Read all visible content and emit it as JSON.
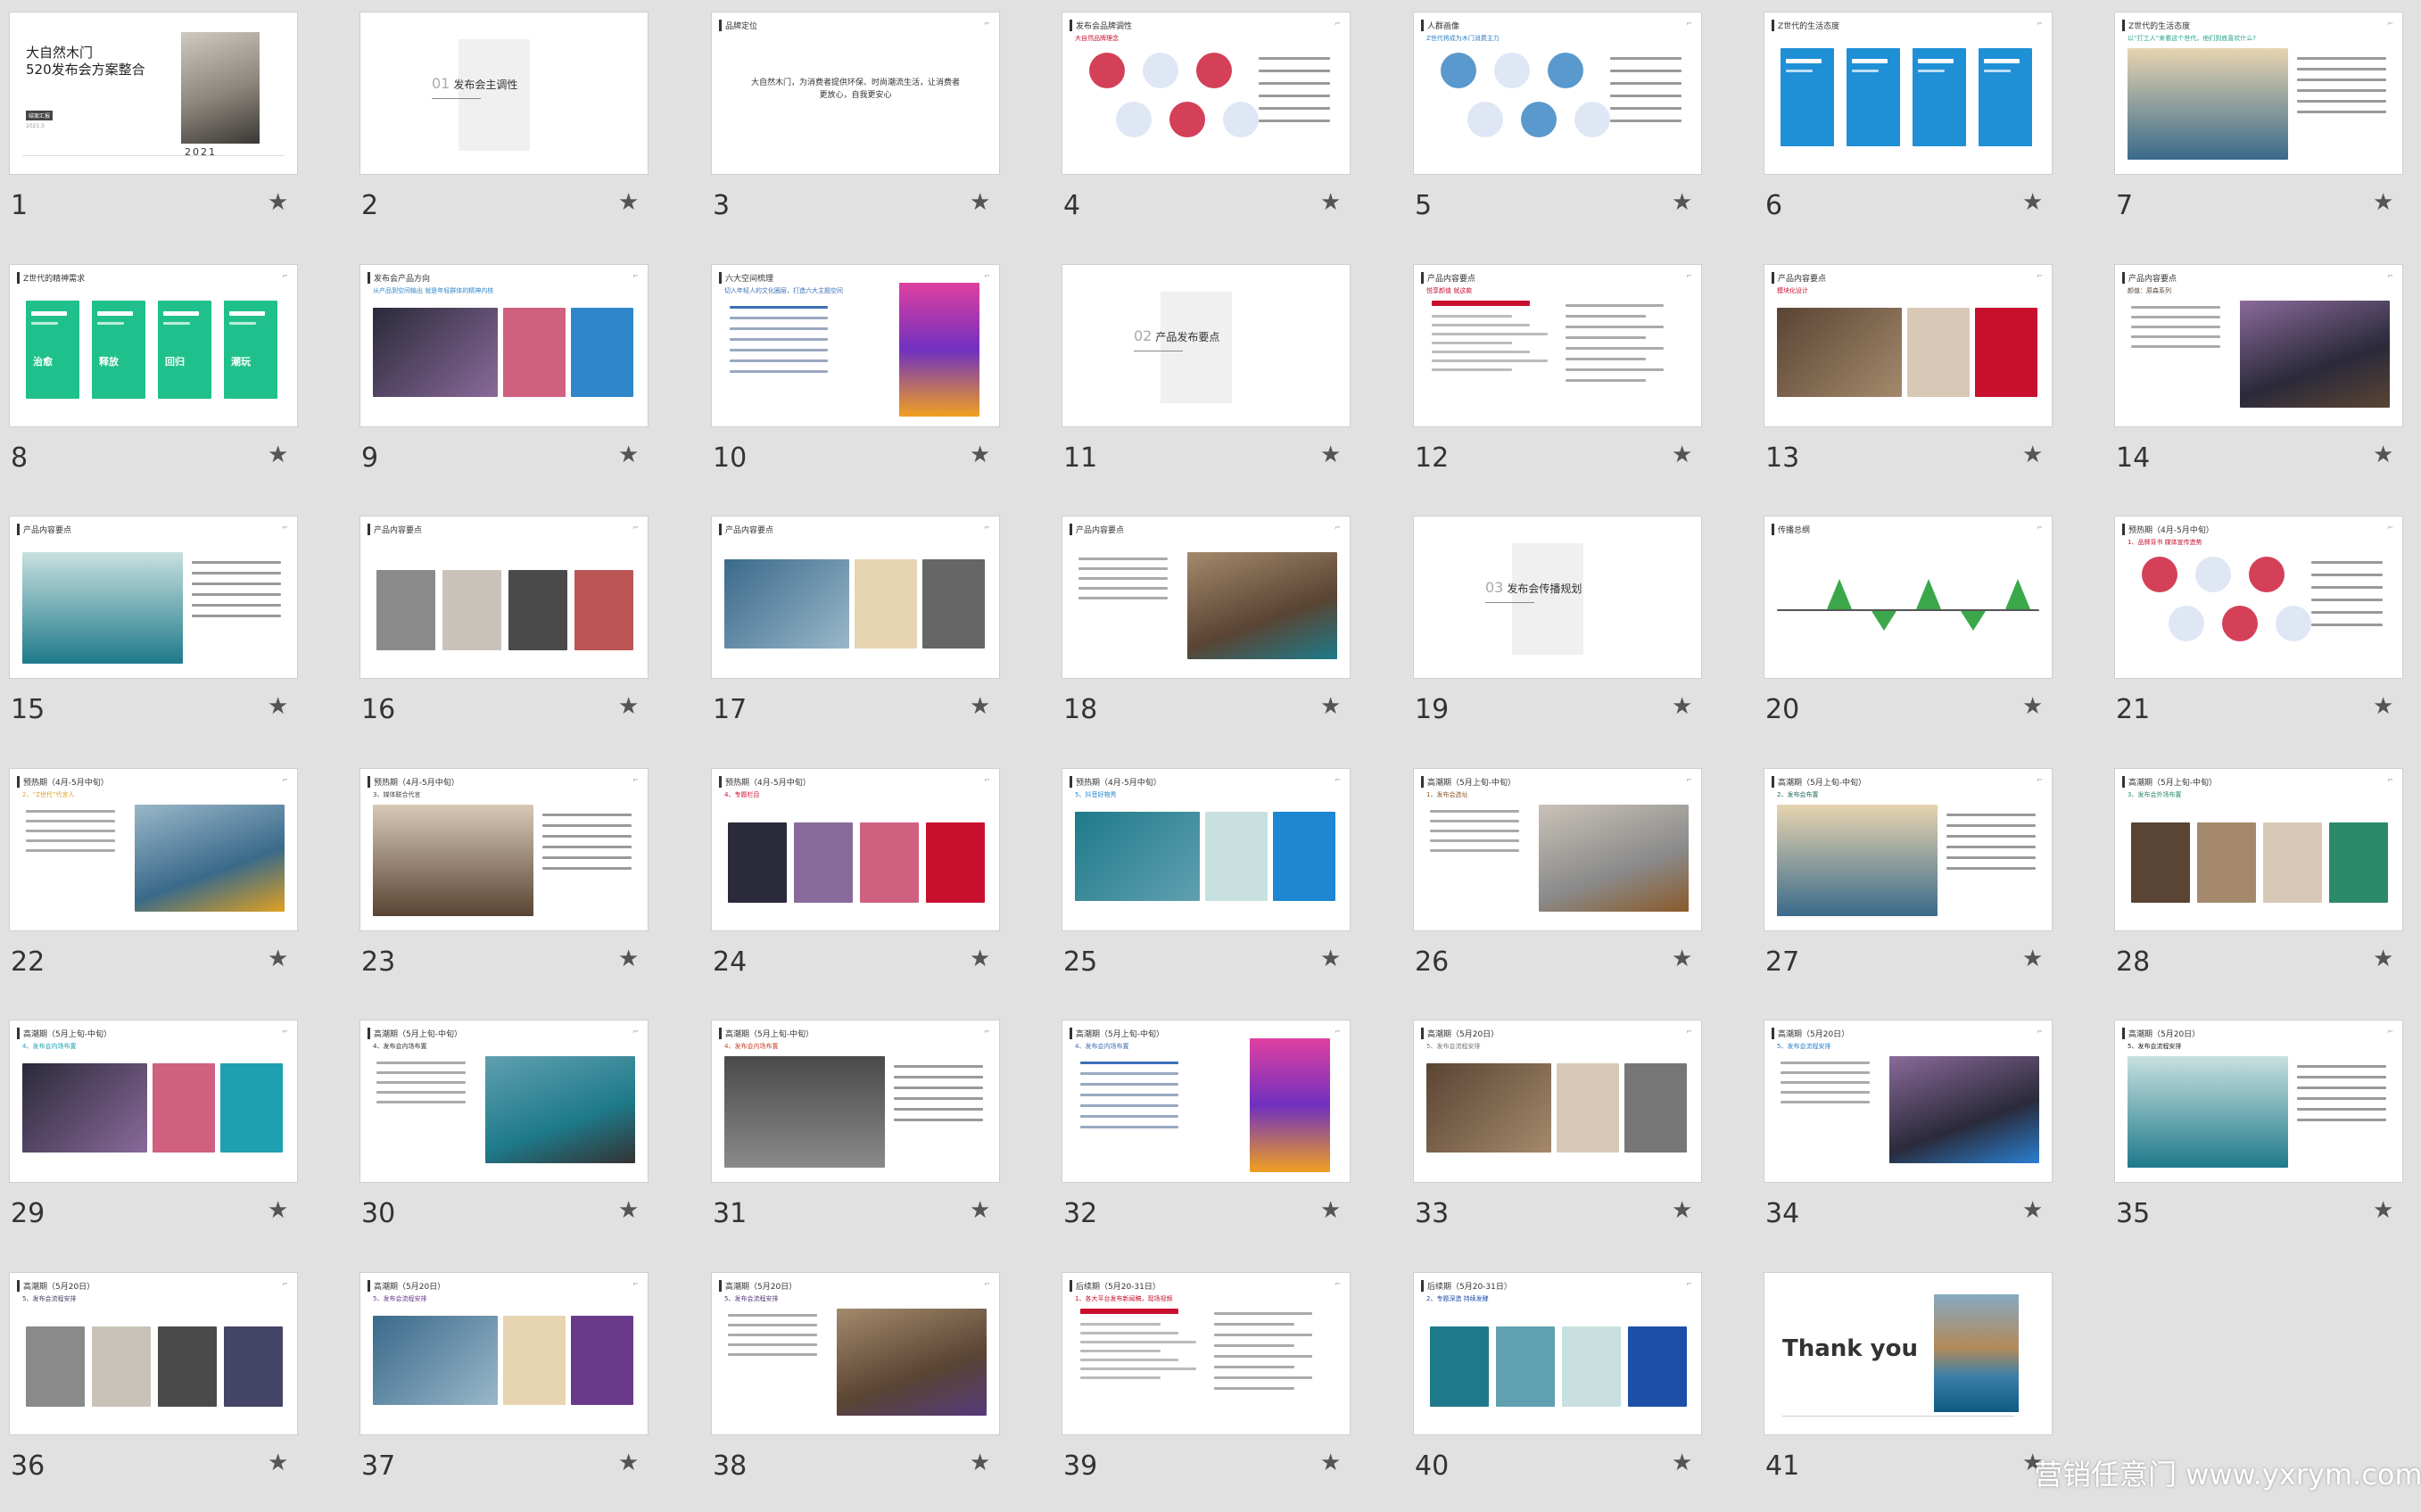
{
  "slides": [
    {
      "n": "1",
      "kind": "cover",
      "title_line1": "大自然木门",
      "title_line2": "520发布会方案整合",
      "tag": "结案汇报",
      "date": "2021.5",
      "year": "2021"
    },
    {
      "n": "2",
      "kind": "section",
      "index": "01",
      "title": "发布会主调性"
    },
    {
      "n": "3",
      "kind": "text",
      "title": "品牌定位",
      "center": "大自然木门，为消费者提供环保、时尚潮流生活，让消费者更放心，自我更安心",
      "accent": "#c8102e"
    },
    {
      "n": "4",
      "kind": "diagram",
      "title": "发布会品牌调性",
      "sub": "大自然品牌理念",
      "accent": "#c8102e"
    },
    {
      "n": "5",
      "kind": "diagram",
      "title": "人群画像",
      "sub": "Z世代将成为木门消费主力",
      "accent": "#2f7fc1"
    },
    {
      "n": "6",
      "kind": "blocks",
      "title": "Z世代的生活态度",
      "accent": "#1f8fd6"
    },
    {
      "n": "7",
      "kind": "photo",
      "title": "Z世代的生活态度",
      "sub": "以“打工人”来看这个世代，他们到底喜欢什么?",
      "accent": "#1fa38a"
    },
    {
      "n": "8",
      "kind": "blocks",
      "title": "Z世代的精神需求",
      "words": [
        "治愈",
        "释放",
        "回归",
        "潮玩"
      ],
      "accent": "#20c08c"
    },
    {
      "n": "9",
      "kind": "photo",
      "title": "发布会产品方向",
      "sub": "从产品到空间输出 就是年轻群体的精神内核",
      "accent": "#2f86c8"
    },
    {
      "n": "10",
      "kind": "list",
      "title": "六大空间梳理",
      "sub": "切入年轻人的文化圈层，打造六大主题空间",
      "accent": "#3b6fb6"
    },
    {
      "n": "11",
      "kind": "section",
      "index": "02",
      "title": "产品发布要点"
    },
    {
      "n": "12",
      "kind": "text",
      "title": "产品内容要点",
      "sub": "悦享颜值 就这款",
      "accent": "#c8102e"
    },
    {
      "n": "13",
      "kind": "photo",
      "title": "产品内容要点",
      "sub": "模块化设计",
      "accent": "#c8102e"
    },
    {
      "n": "14",
      "kind": "photo",
      "title": "产品内容要点",
      "sub": "颜值：原森系列",
      "accent": "#5a4433"
    },
    {
      "n": "15",
      "kind": "photo",
      "title": "产品内容要点",
      "accent": "#555"
    },
    {
      "n": "16",
      "kind": "photo",
      "title": "产品内容要点",
      "accent": "#b55"
    },
    {
      "n": "17",
      "kind": "photo",
      "title": "产品内容要点",
      "accent": "#666"
    },
    {
      "n": "18",
      "kind": "photo",
      "title": "产品内容要点",
      "accent": "#1e7a8a"
    },
    {
      "n": "19",
      "kind": "section",
      "index": "03",
      "title": "发布会传播规划"
    },
    {
      "n": "20",
      "kind": "chart",
      "title": "传播总纲",
      "accent": "#3aa84a"
    },
    {
      "n": "21",
      "kind": "diagram",
      "title": "预热期（4月-5月中旬）",
      "sub": "1、品牌背书 媒体宣传造势",
      "accent": "#c8102e"
    },
    {
      "n": "22",
      "kind": "photo",
      "title": "预热期（4月-5月中旬）",
      "sub": "2、“Z世代”代言人",
      "accent": "#e0a020"
    },
    {
      "n": "23",
      "kind": "photo",
      "title": "预热期（4月-5月中旬）",
      "sub": "3、媒体联合代言",
      "accent": "#444"
    },
    {
      "n": "24",
      "kind": "photo",
      "title": "预热期（4月-5月中旬）",
      "sub": "4、专题栏目",
      "accent": "#c8102e"
    },
    {
      "n": "25",
      "kind": "photo",
      "title": "预热期（4月-5月中旬）",
      "sub": "5、抖音好物秀",
      "accent": "#1d87d1"
    },
    {
      "n": "26",
      "kind": "photo",
      "title": "高潮期（5月上旬-中旬）",
      "sub": "1、发布会选址",
      "accent": "#8a5a2a"
    },
    {
      "n": "27",
      "kind": "photo",
      "title": "高潮期（5月上旬-中旬）",
      "sub": "2、发布会布置",
      "accent": "#1e6e5e"
    },
    {
      "n": "28",
      "kind": "photo",
      "title": "高潮期（5月上旬-中旬）",
      "sub": "3、发布会外场布置",
      "accent": "#2a8a6a"
    },
    {
      "n": "29",
      "kind": "photo",
      "title": "高潮期（5月上旬-中旬）",
      "sub": "4、发布会内场布置",
      "accent": "#1ea0b0"
    },
    {
      "n": "30",
      "kind": "photo",
      "title": "高潮期（5月上旬-中旬）",
      "sub": "4、发布会内场布置",
      "accent": "#333"
    },
    {
      "n": "31",
      "kind": "photo",
      "title": "高潮期（5月上旬-中旬）",
      "sub": "4、发布会内场布置",
      "accent": "#c8402e"
    },
    {
      "n": "32",
      "kind": "list",
      "title": "高潮期（5月上旬-中旬）",
      "sub": "4、发布会内场布置",
      "accent": "#3b6fb6"
    },
    {
      "n": "33",
      "kind": "photo",
      "title": "高潮期（5月20日）",
      "sub": "5、发布会流程安排",
      "accent": "#777"
    },
    {
      "n": "34",
      "kind": "photo",
      "title": "高潮期（5月20日）",
      "sub": "5、发布会流程安排",
      "accent": "#2a7fd0"
    },
    {
      "n": "35",
      "kind": "photo",
      "title": "高潮期（5月20日）",
      "sub": "5、发布会流程安排",
      "accent": "#222"
    },
    {
      "n": "36",
      "kind": "photo",
      "title": "高潮期（5月20日）",
      "sub": "5、发布会流程安排",
      "accent": "#446"
    },
    {
      "n": "37",
      "kind": "photo",
      "title": "高潮期（5月20日）",
      "sub": "5、发布会流程安排",
      "accent": "#6a3a8a"
    },
    {
      "n": "38",
      "kind": "photo",
      "title": "高潮期（5月20日）",
      "sub": "5、发布会流程安排",
      "accent": "#553a7a"
    },
    {
      "n": "39",
      "kind": "text",
      "title": "后续期（5月20-31日）",
      "sub": "1、各大平台发布新闻稿，现场视频",
      "accent": "#c8102e"
    },
    {
      "n": "40",
      "kind": "photo",
      "title": "后续期（5月20-31日）",
      "sub": "2、专题深造 持续发酵",
      "accent": "#1d4fa8"
    },
    {
      "n": "41",
      "kind": "thanks",
      "title": "Thank you"
    }
  ],
  "star_glyph": "★",
  "watermark": "营销任意门 www.yxrym.com"
}
